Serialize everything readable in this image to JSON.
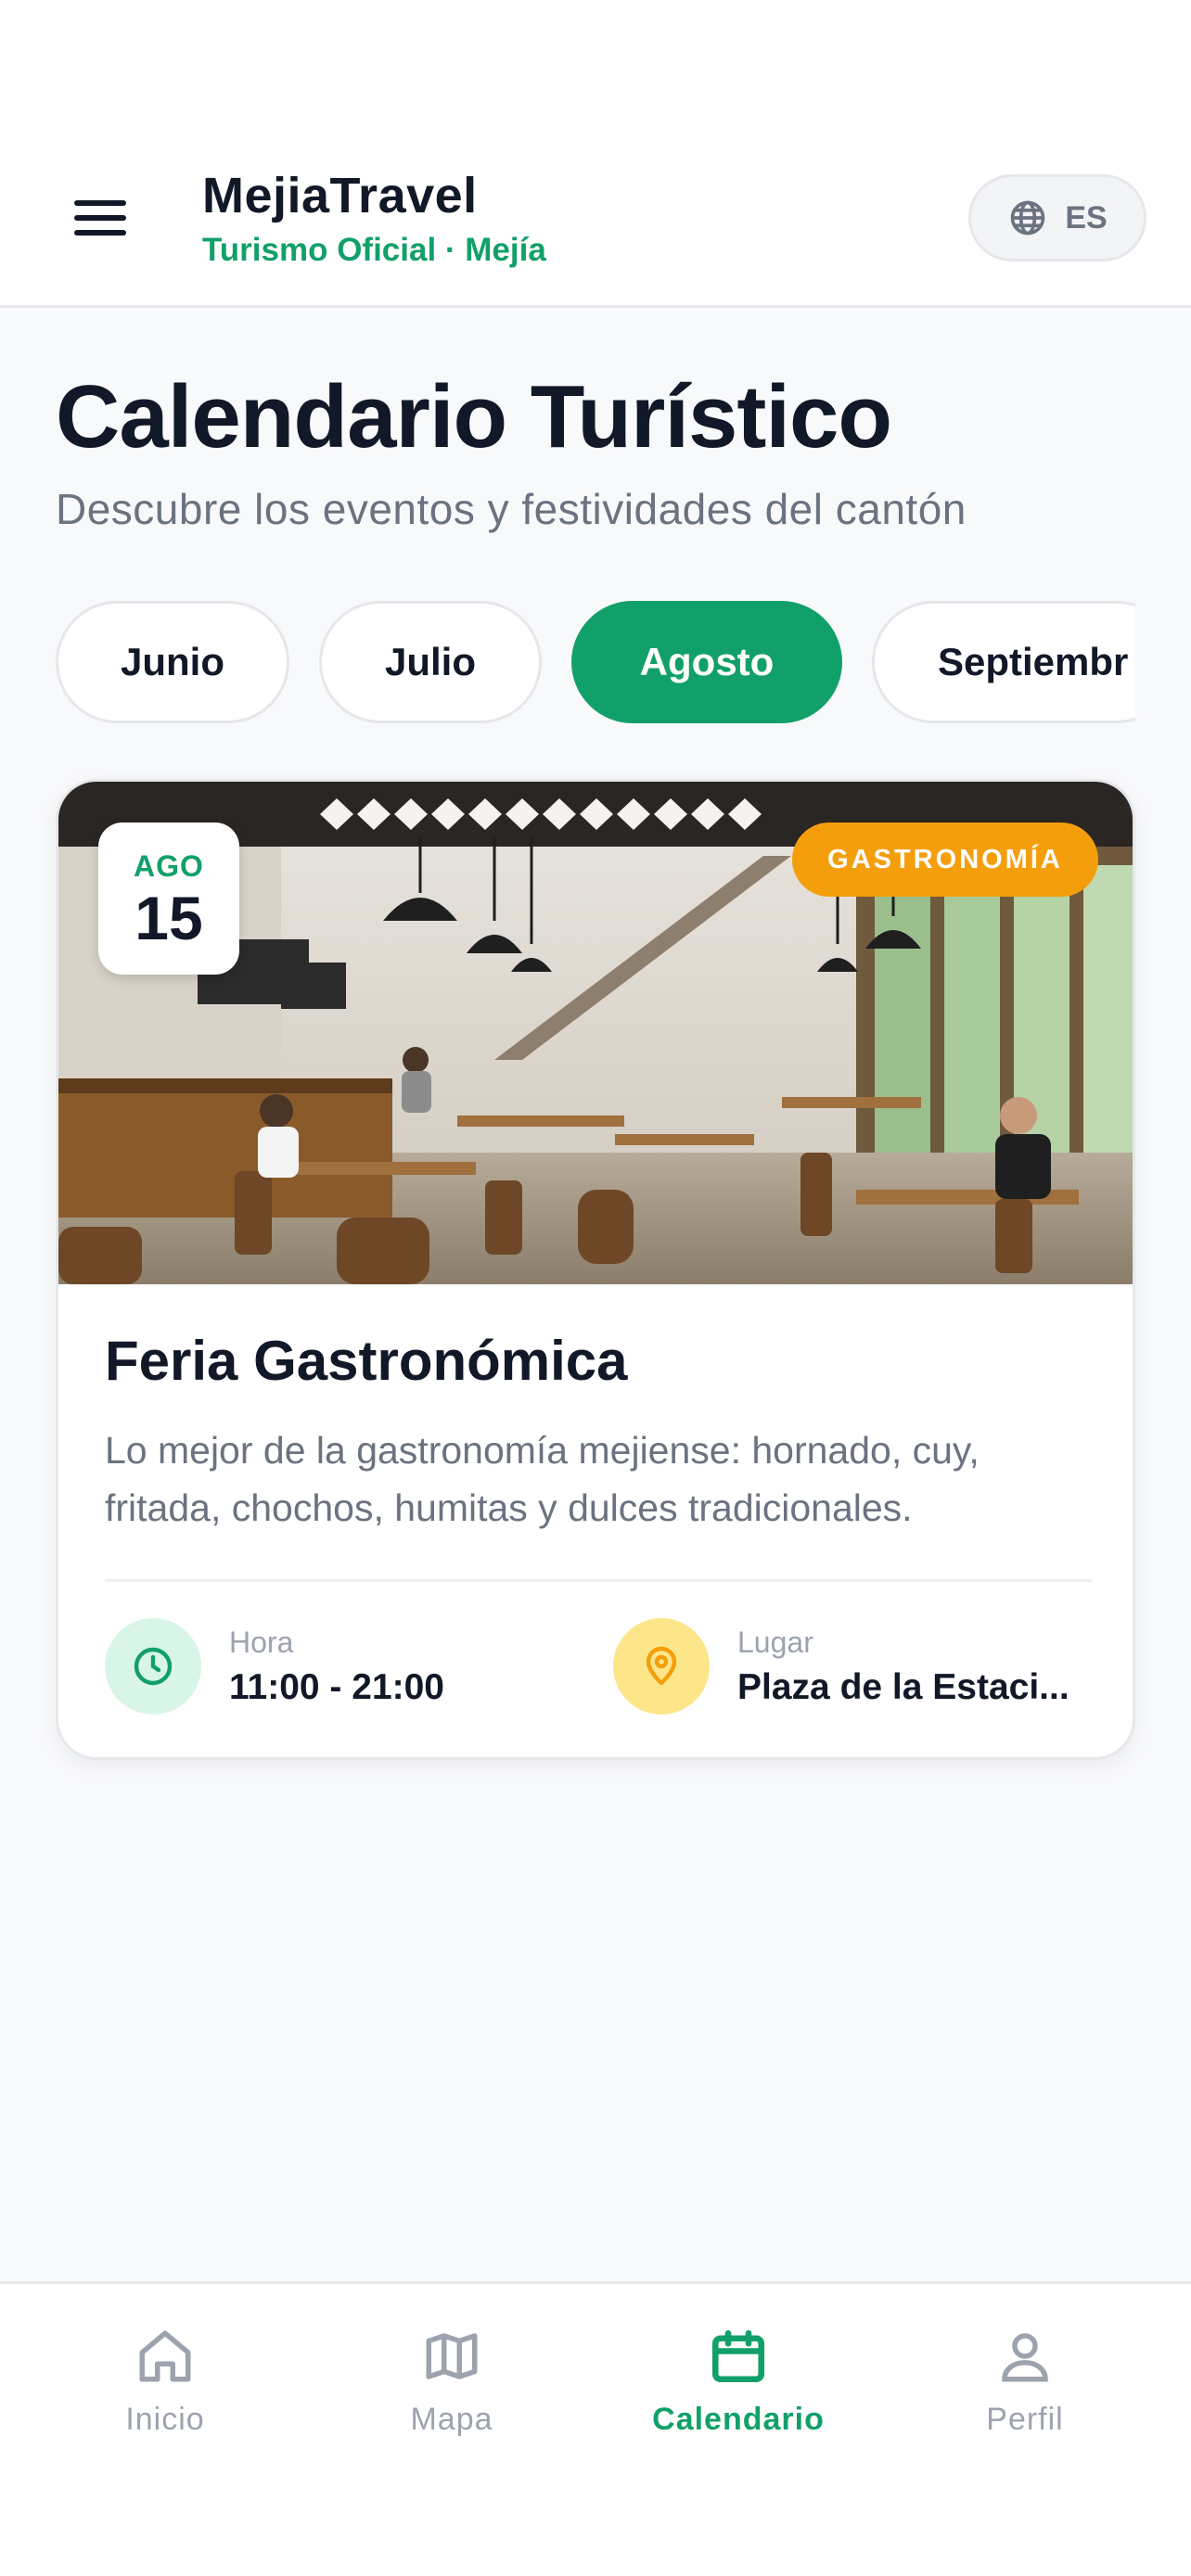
{
  "header": {
    "brand_title": "MejiaTravel",
    "brand_subtitle": "Turismo Oficial · Mejía",
    "language": "ES",
    "menu_icon": "hamburger-menu-icon",
    "language_icon": "globe-icon"
  },
  "page": {
    "title": "Calendario Turístico",
    "subtitle": "Descubre los eventos y festividades del cantón"
  },
  "months": [
    {
      "label": "Junio",
      "selected": false
    },
    {
      "label": "Julio",
      "selected": false
    },
    {
      "label": "Agosto",
      "selected": true
    },
    {
      "label": "Septiembr",
      "selected": false
    }
  ],
  "event": {
    "date_month": "AGO",
    "date_day": "15",
    "category": "GASTRONOMÍA",
    "title": "Feria Gastronómica",
    "description": "Lo mejor de la gastronomía mejiense: hornado, cuy, fritada, chochos, humitas y dulces tradicionales.",
    "time_label": "Hora",
    "time_value": "11:00 - 21:00",
    "place_label": "Lugar",
    "place_value": "Plaza de la Estaci...",
    "image_icon": "restaurant-photo"
  },
  "nav": [
    {
      "label": "Inicio",
      "icon": "home-icon",
      "active": false
    },
    {
      "label": "Mapa",
      "icon": "map-icon",
      "active": false
    },
    {
      "label": "Calendario",
      "icon": "calendar-icon",
      "active": true
    },
    {
      "label": "Perfil",
      "icon": "user-icon",
      "active": false
    }
  ],
  "colors": {
    "accent": "#12a06a",
    "category": "#f59e0b",
    "text": "#111827",
    "muted": "#6b7280"
  }
}
